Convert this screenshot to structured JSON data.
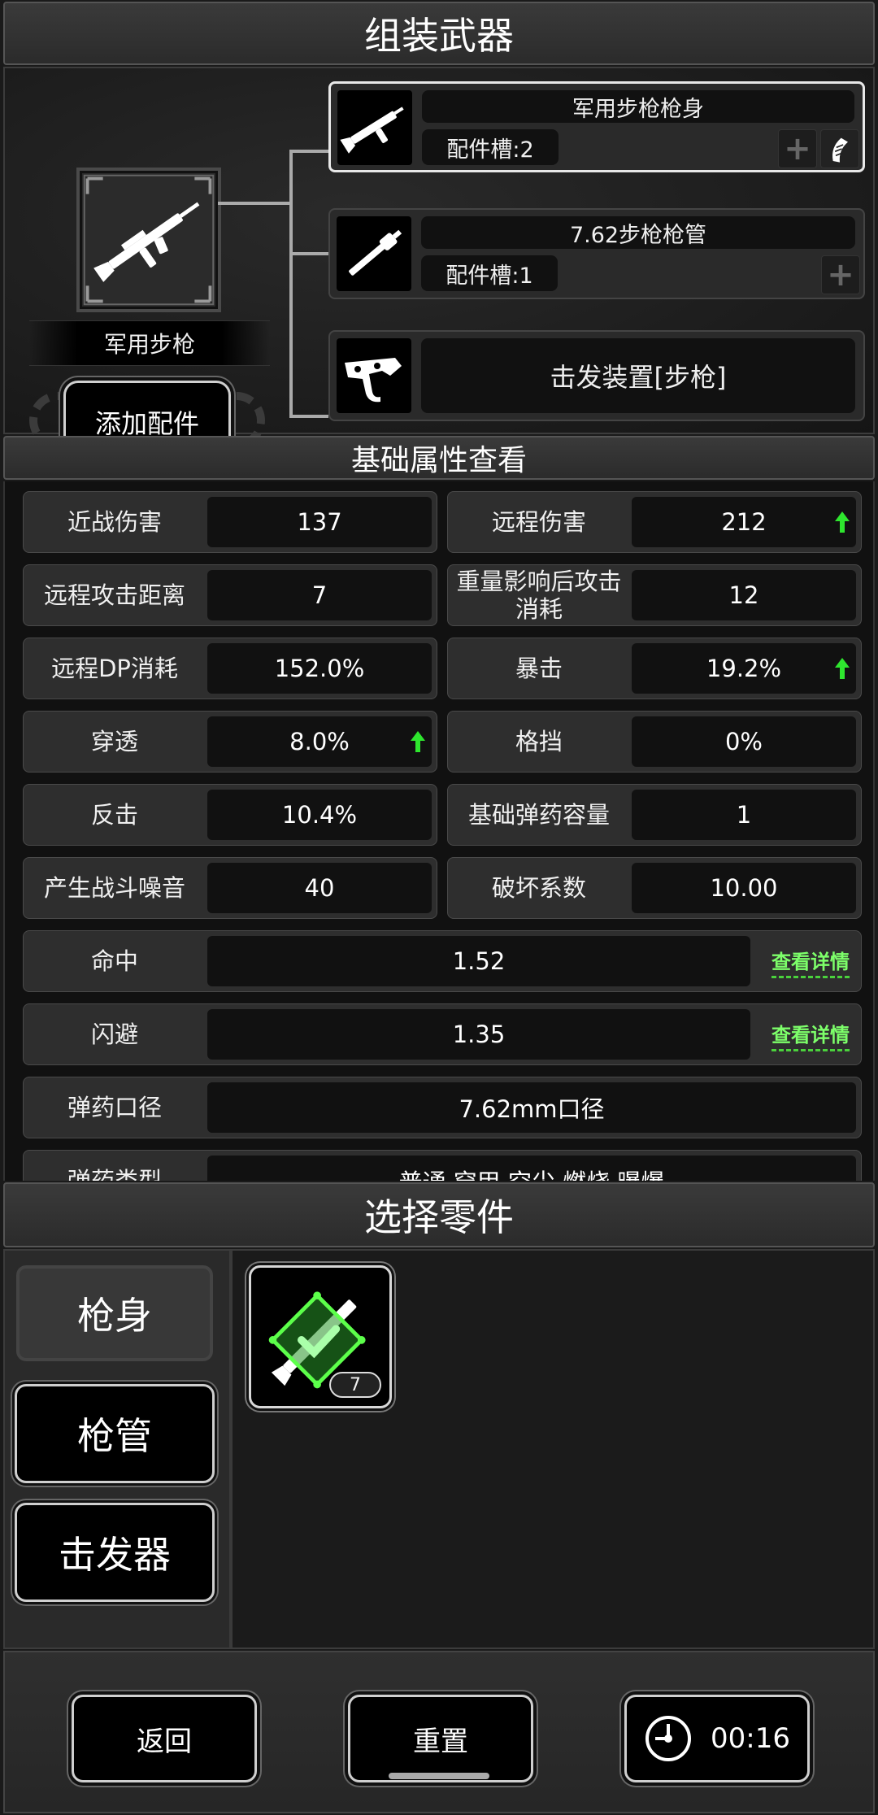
{
  "header": {
    "title": "组装武器"
  },
  "assembly": {
    "weapon_name": "军用步枪",
    "add_attachment_label": "添加配件",
    "parts": [
      {
        "name": "军用步枪枪身",
        "slots": "配件槽:2",
        "selected": true,
        "icon": "rifle-body-icon"
      },
      {
        "name": "7.62步枪枪管",
        "slots": "配件槽:1",
        "selected": false,
        "icon": "barrel-icon"
      },
      {
        "name": "击发装置[步枪]",
        "selected": false,
        "icon": "trigger-icon"
      }
    ]
  },
  "stats": {
    "title": "基础属性查看",
    "pairs": [
      {
        "label": "近战伤害",
        "value": "137"
      },
      {
        "label": "远程伤害",
        "value": "212",
        "up": true
      },
      {
        "label": "远程攻击距离",
        "value": "7"
      },
      {
        "label": "重量影响后攻击消耗",
        "value": "12"
      },
      {
        "label": "远程DP消耗",
        "value": "152.0%"
      },
      {
        "label": "暴击",
        "value": "19.2%",
        "up": true
      },
      {
        "label": "穿透",
        "value": "8.0%",
        "up": true
      },
      {
        "label": "格挡",
        "value": "0%"
      },
      {
        "label": "反击",
        "value": "10.4%"
      },
      {
        "label": "基础弹药容量",
        "value": "1"
      },
      {
        "label": "产生战斗噪音",
        "value": "40"
      },
      {
        "label": "破坏系数",
        "value": "10.00"
      }
    ],
    "wide": [
      {
        "label": "命中",
        "value": "1.52",
        "detail": "查看详情"
      },
      {
        "label": "闪避",
        "value": "1.35",
        "detail": "查看详情"
      },
      {
        "label": "弹药口径",
        "value": "7.62mm口径"
      },
      {
        "label": "弹药类型",
        "value": "普通 穿甲 空尖 燃烧 曝爆"
      }
    ]
  },
  "select": {
    "title": "选择零件",
    "tabs": [
      {
        "label": "枪身",
        "active": true
      },
      {
        "label": "枪管",
        "active": false
      },
      {
        "label": "击发器",
        "active": false
      }
    ],
    "items": [
      {
        "count": "7",
        "equipped": true
      }
    ]
  },
  "footer": {
    "back_label": "返回",
    "reset_label": "重置",
    "timer": "00:16"
  },
  "colors": {
    "accent_green": "#4ad13c",
    "detail_green": "#7dff6a"
  }
}
